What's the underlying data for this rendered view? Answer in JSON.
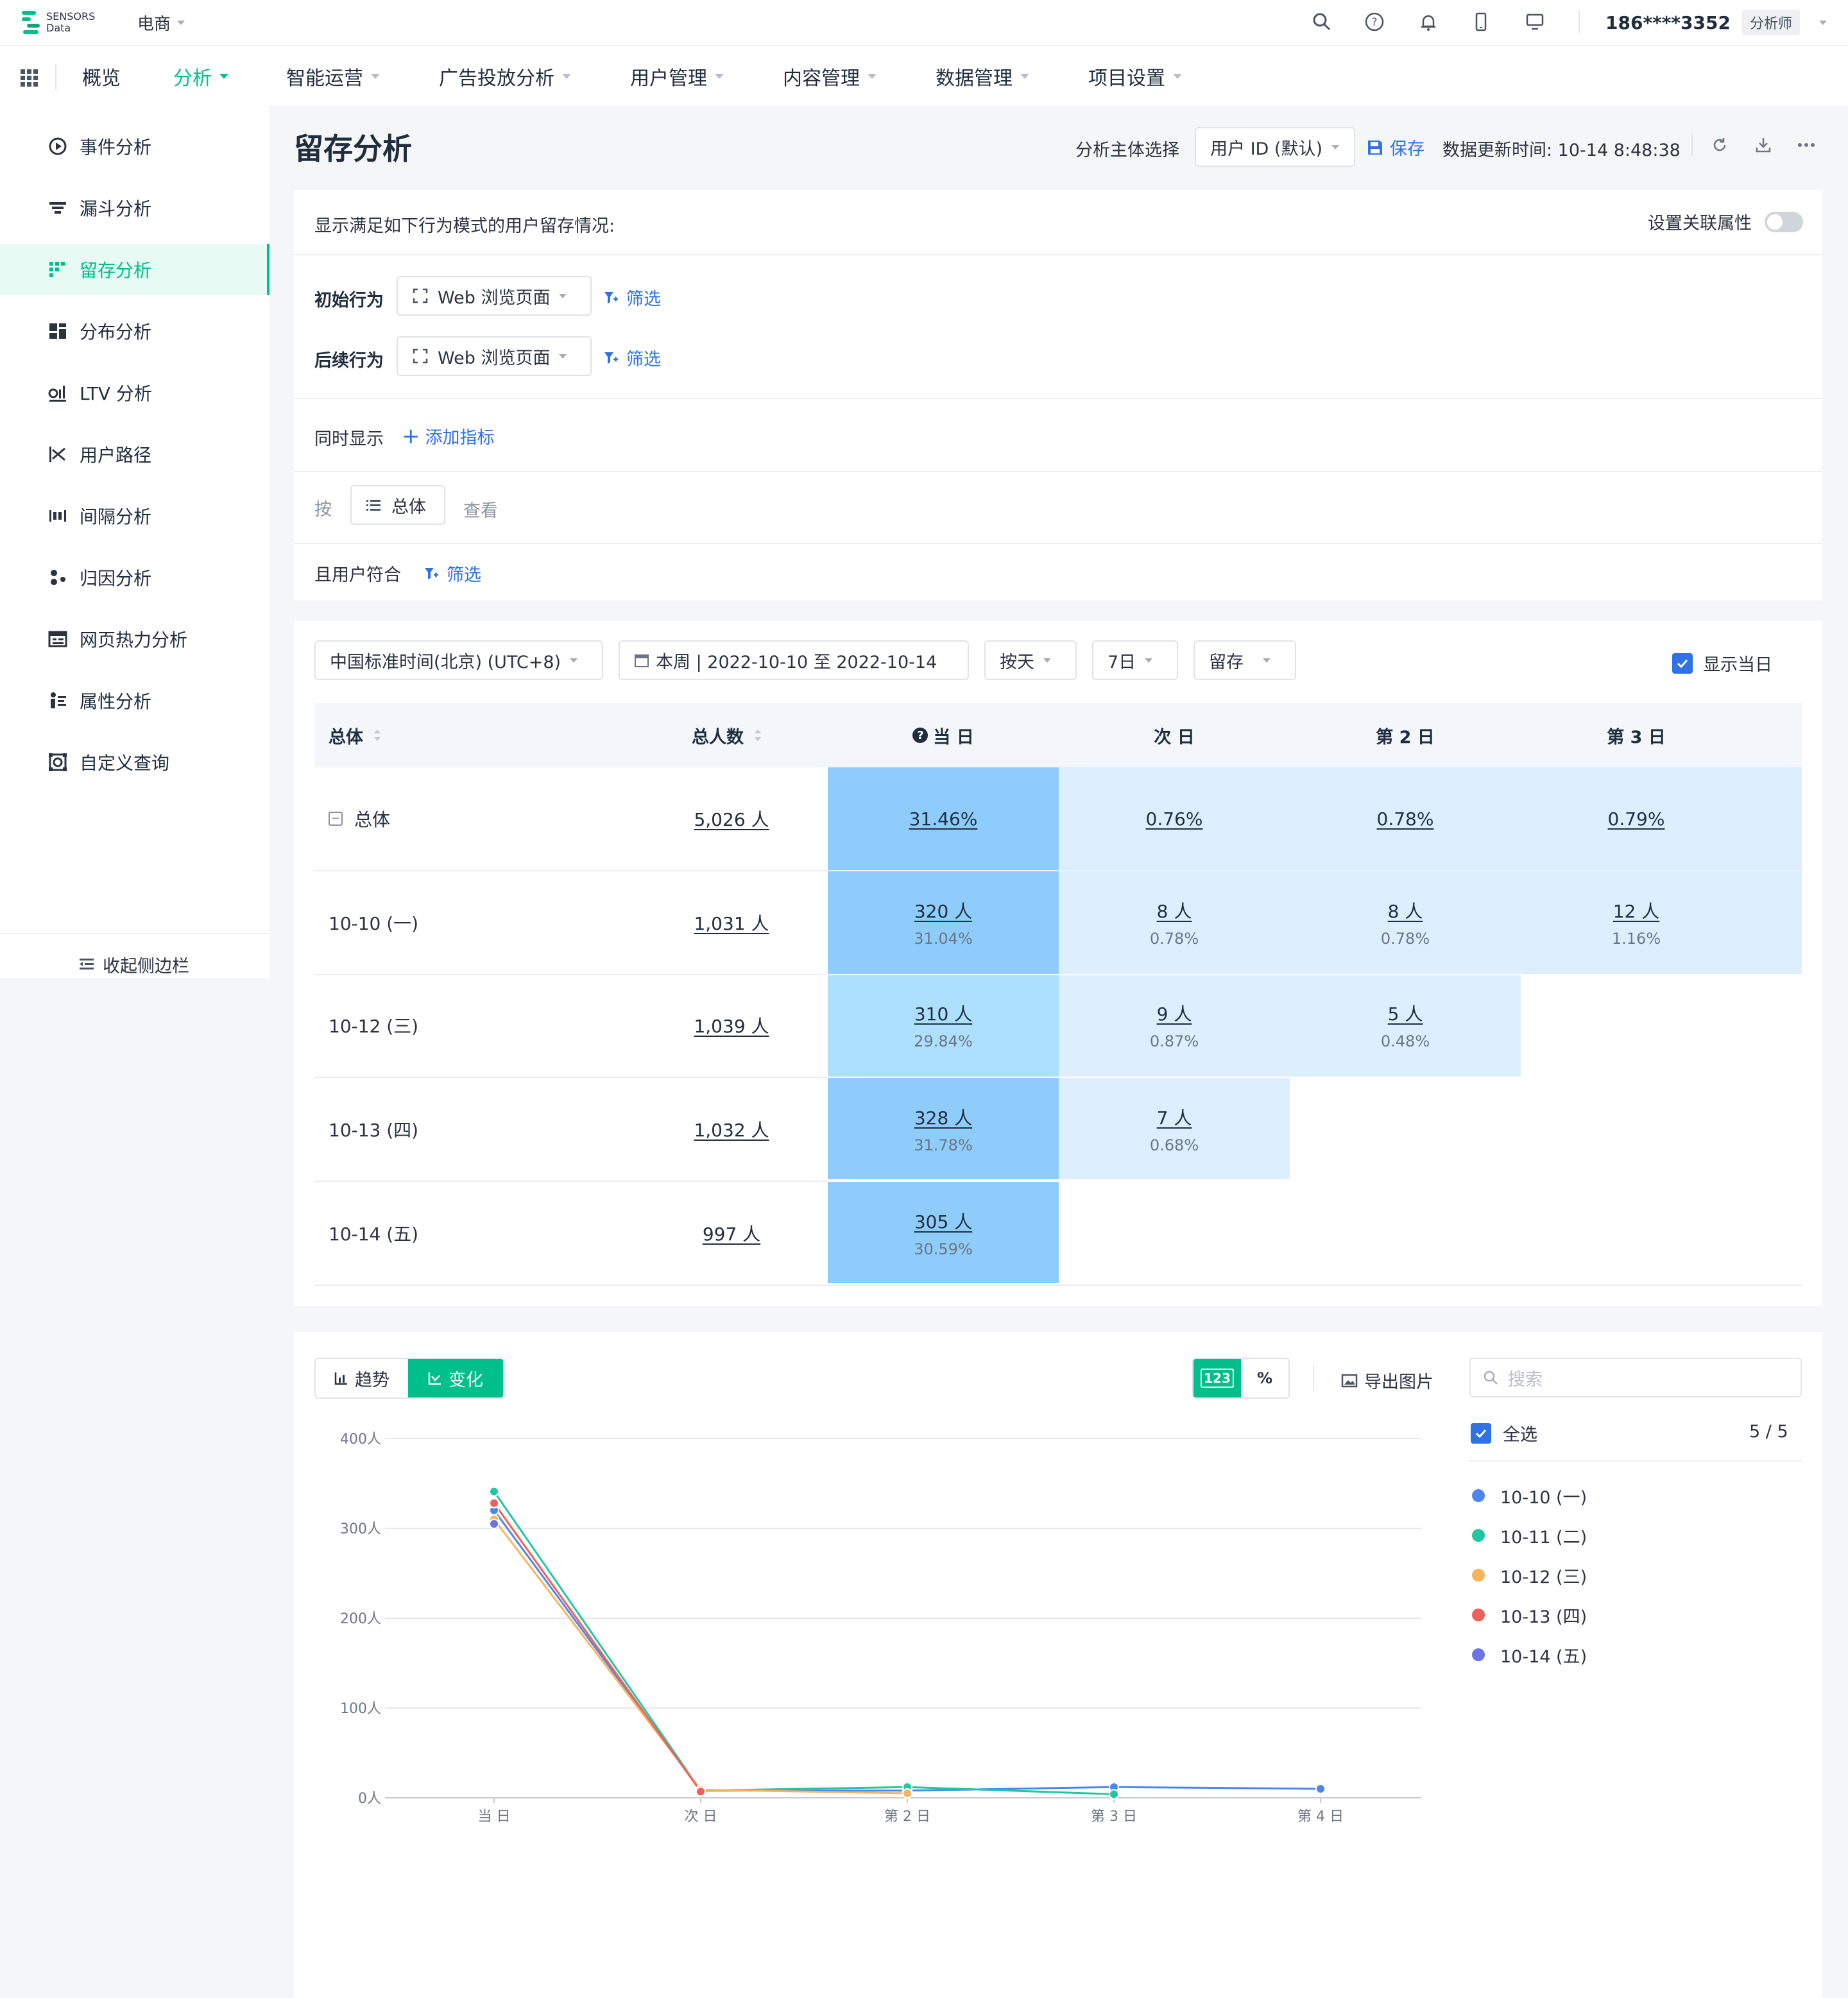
{
  "topbar": {
    "logo_text_1": "SENSORS",
    "logo_text_2": "Data",
    "project": "电商",
    "user": "186****3352",
    "role": "分析师"
  },
  "nav": {
    "items": [
      {
        "label": "概览"
      },
      {
        "label": "分析"
      },
      {
        "label": "智能运营"
      },
      {
        "label": "广告投放分析"
      },
      {
        "label": "用户管理"
      },
      {
        "label": "内容管理"
      },
      {
        "label": "数据管理"
      },
      {
        "label": "项目设置"
      }
    ]
  },
  "sidebar": {
    "items": [
      {
        "label": "事件分析",
        "icon": "event-icon"
      },
      {
        "label": "漏斗分析",
        "icon": "funnel-icon"
      },
      {
        "label": "留存分析",
        "icon": "retention-icon"
      },
      {
        "label": "分布分析",
        "icon": "distribution-icon"
      },
      {
        "label": "LTV 分析",
        "icon": "ltv-icon"
      },
      {
        "label": "用户路径",
        "icon": "path-icon"
      },
      {
        "label": "间隔分析",
        "icon": "interval-icon"
      },
      {
        "label": "归因分析",
        "icon": "attribution-icon"
      },
      {
        "label": "网页热力分析",
        "icon": "heatmap-icon"
      },
      {
        "label": "属性分析",
        "icon": "property-icon"
      },
      {
        "label": "自定义查询",
        "icon": "query-icon"
      }
    ],
    "collapse_label": "收起侧边栏"
  },
  "page": {
    "title": "留存分析",
    "subject_label": "分析主体选择",
    "subject_value": "用户 ID (默认)",
    "save_label": "保存",
    "update_time": "数据更新时间: 10-14 8:48:38"
  },
  "query": {
    "desc": "显示满足如下行为模式的用户留存情况:",
    "relation_label": "设置关联属性",
    "initial_label": "初始行为",
    "initial_value": "Web 浏览页面",
    "followup_label": "后续行为",
    "followup_value": "Web 浏览页面",
    "filter_label": "筛选",
    "also_show": "同时显示",
    "add_metric": "添加指标",
    "by_label": "按",
    "group_value": "总体",
    "view_label": "查看",
    "user_match": "且用户符合"
  },
  "controls": {
    "timezone": "中国标准时间(北京) (UTC+8)",
    "date_range": "本周 | 2022-10-10 至 2022-10-14",
    "granularity": "按天",
    "window": "7日",
    "metric": "留存",
    "show_today": "显示当日"
  },
  "table": {
    "headers": [
      "总体",
      "总人数",
      "当 日",
      "次 日",
      "第 2 日",
      "第 3 日"
    ],
    "rows": [
      {
        "label": "总体",
        "total": "5,026 人",
        "cells": [
          {
            "main": "31.46%",
            "sub": ""
          },
          {
            "main": "0.76%",
            "sub": ""
          },
          {
            "main": "0.78%",
            "sub": ""
          },
          {
            "main": "0.79%",
            "sub": ""
          }
        ]
      },
      {
        "label": "10-10 (一)",
        "total": "1,031 人",
        "cells": [
          {
            "main": "320 人",
            "sub": "31.04%"
          },
          {
            "main": "8 人",
            "sub": "0.78%"
          },
          {
            "main": "8 人",
            "sub": "0.78%"
          },
          {
            "main": "12 人",
            "sub": "1.16%"
          }
        ]
      },
      {
        "label": "10-12 (三)",
        "total": "1,039 人",
        "cells": [
          {
            "main": "310 人",
            "sub": "29.84%"
          },
          {
            "main": "9 人",
            "sub": "0.87%"
          },
          {
            "main": "5 人",
            "sub": "0.48%"
          }
        ]
      },
      {
        "label": "10-13 (四)",
        "total": "1,032 人",
        "cells": [
          {
            "main": "328 人",
            "sub": "31.78%"
          },
          {
            "main": "7 人",
            "sub": "0.68%"
          }
        ]
      },
      {
        "label": "10-14 (五)",
        "total": "997 人",
        "cells": [
          {
            "main": "305 人",
            "sub": "30.59%"
          }
        ]
      }
    ]
  },
  "chart_panel": {
    "tab_trend": "趋势",
    "tab_change": "变化",
    "mode_num": "123",
    "mode_pct": "%",
    "export": "导出图片",
    "search_placeholder": "搜索",
    "select_all": "全选",
    "count": "5 / 5"
  },
  "chart_data": {
    "type": "line",
    "categories": [
      "当 日",
      "次 日",
      "第 2 日",
      "第 3 日",
      "第 4 日"
    ],
    "yticks": [
      "0人",
      "100人",
      "200人",
      "300人",
      "400人"
    ],
    "ylim": [
      0,
      400
    ],
    "series": [
      {
        "name": "10-10 (一)",
        "color": "#4e86f0",
        "values": [
          320,
          8,
          8,
          12,
          10
        ]
      },
      {
        "name": "10-11 (二)",
        "color": "#22c7a0",
        "values": [
          341,
          8,
          12,
          4,
          null
        ]
      },
      {
        "name": "10-12 (三)",
        "color": "#f7b45a",
        "values": [
          310,
          9,
          5,
          null,
          null
        ]
      },
      {
        "name": "10-13 (四)",
        "color": "#f0605a",
        "values": [
          328,
          7,
          null,
          null,
          null
        ]
      },
      {
        "name": "10-14 (五)",
        "color": "#6a73e8",
        "values": [
          305,
          null,
          null,
          null,
          null
        ]
      }
    ]
  }
}
